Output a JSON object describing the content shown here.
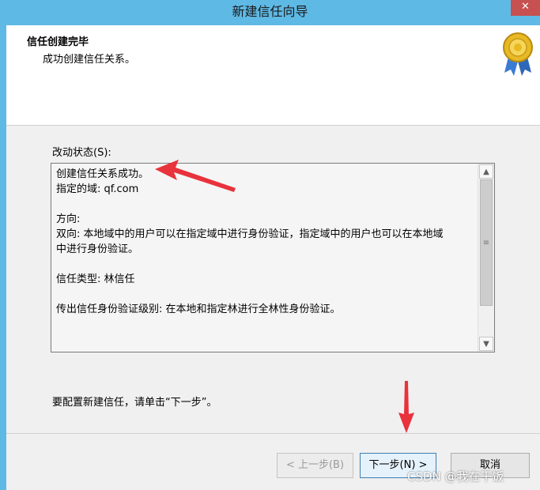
{
  "window": {
    "title": "新建信任向导",
    "close_label": "✕"
  },
  "header": {
    "title": "信任创建完毕",
    "subtitle": "成功创建信任关系。"
  },
  "status": {
    "label": "改动状态(S):",
    "text": "创建信任关系成功。\n指定的域: qf.com\n\n方向:\n双向: 本地域中的用户可以在指定域中进行身份验证，指定域中的用户也可以在本地域\n中进行身份验证。\n\n信任类型: 林信任\n\n传出信任身份验证级别: 在本地和指定林进行全林性身份验证。"
  },
  "instruction": "要配置新建信任，请单击“下一步”。",
  "buttons": {
    "back": "< 上一步(B)",
    "next": "下一步(N) >",
    "cancel": "取消"
  },
  "watermark": "CSDN @我在干饭",
  "colors": {
    "titlebar": "#5fb9e5",
    "close": "#c75050",
    "annotation": "#e8323c"
  },
  "icons": {
    "seal": "award-seal-icon",
    "scroll_up": "chevron-up-icon",
    "scroll_down": "chevron-down-icon"
  }
}
